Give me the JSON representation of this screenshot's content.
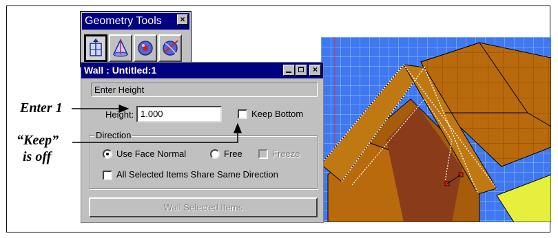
{
  "toolbar": {
    "title": "Geometry Tools",
    "close_glyph": "×",
    "buttons": [
      {
        "icon": "wall-tool-icon",
        "active": true
      },
      {
        "icon": "cone-tool-icon",
        "active": false
      },
      {
        "icon": "sphere-tool-icon",
        "active": false
      },
      {
        "icon": "rotate-sphere-icon",
        "active": false
      }
    ]
  },
  "dialog": {
    "title": "Wall : Untitled:1",
    "prompt": "Enter Height",
    "height_label": "Height:",
    "height_value": "1.000",
    "keep_bottom_label": "Keep Bottom",
    "keep_bottom_checked": false,
    "direction_label": "Direction",
    "use_face_normal_label": "Use Face Normal",
    "use_face_normal_selected": true,
    "free_label": "Free",
    "free_selected": false,
    "freeze_label": "Freeze",
    "freeze_enabled": false,
    "all_selected_label": "All Selected Items Share Same Direction",
    "all_selected_checked": false,
    "wall_button_label": "Wall Selected Items"
  },
  "callouts": {
    "enter": "Enter 1",
    "keep_line1": "“Keep”",
    "keep_line2": "is off"
  },
  "colors": {
    "titlebar": "#000080",
    "panel": "#c0c0c0",
    "viewport_bg": "#3a6fe8",
    "roof": "#b86a0c",
    "accent_yellow": "#e6f03c"
  }
}
